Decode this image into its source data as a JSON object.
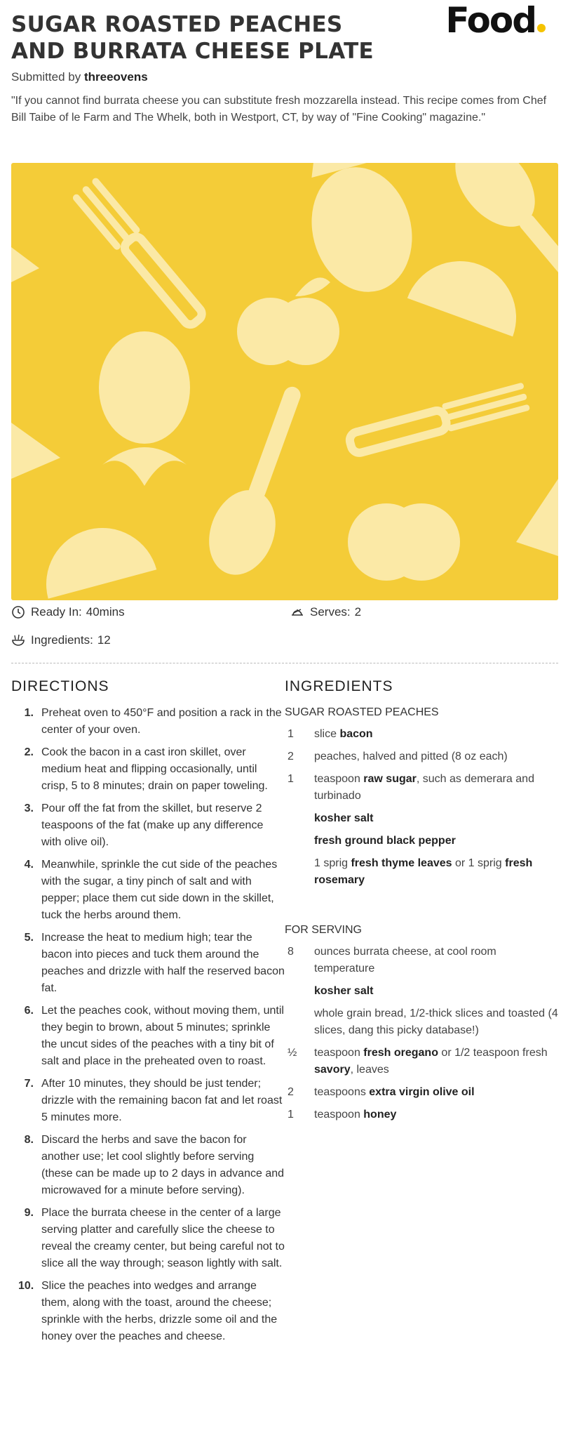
{
  "brand": {
    "logo_text": "Food",
    "accent": "#f5c300"
  },
  "recipe": {
    "title": "SUGAR ROASTED PEACHES AND BURRATA CHEESE PLATE",
    "submitted_prefix": "Submitted by",
    "author": "threeovens",
    "description": "\"If you cannot find burrata cheese you can substitute fresh mozzarella instead. This recipe comes from Chef Bill Taibe of le Farm and The Whelk, both in Westport, CT, by way of \"Fine Cooking\" magazine.\"",
    "hero_color": "#f4cc38"
  },
  "meta": {
    "ready_label": "Ready In:",
    "ready_value": "40mins",
    "serves_label": "Serves:",
    "serves_value": "2",
    "ingredients_label": "Ingredients:",
    "ingredients_value": "12"
  },
  "directions": {
    "title": "DIRECTIONS",
    "steps": [
      {
        "n": "1.",
        "text": "Preheat oven to 450°F and position a rack in the center of your oven."
      },
      {
        "n": "2.",
        "text": "Cook the bacon in a cast iron skillet, over medium heat and flipping occasionally, until crisp, 5 to 8 minutes; drain on paper toweling."
      },
      {
        "n": "3.",
        "text": "Pour off the fat from the skillet, but reserve 2 teaspoons of the fat (make up any difference with olive oil)."
      },
      {
        "n": "4.",
        "text": "Meanwhile, sprinkle the cut side of the peaches with the sugar, a tiny pinch of salt and with pepper; place them cut side down in the skillet, tuck the herbs around them."
      },
      {
        "n": "5.",
        "text": "Increase the heat to medium high; tear the bacon into pieces and tuck them around the peaches and drizzle with half the reserved bacon fat."
      },
      {
        "n": "6.",
        "text": "Let the peaches cook, without moving them, until they begin to brown, about 5 minutes; sprinkle the uncut sides of the peaches with a tiny bit of salt and place in the preheated oven to roast."
      },
      {
        "n": "7.",
        "text": "After 10 minutes, they should be just tender; drizzle with the remaining bacon fat and let roast 5 minutes more."
      },
      {
        "n": "8.",
        "text": "Discard the herbs and save the bacon for another use; let cool slightly before serving (these can be made up to 2 days in advance and microwaved for a minute before serving)."
      },
      {
        "n": "9.",
        "text": "Place the burrata cheese in the center of a large serving platter and carefully slice the cheese to reveal the creamy center, but being careful not to slice all the way through; season lightly with salt."
      },
      {
        "n": "10.",
        "text": "Slice the peaches into wedges and arrange them, along with the toast, around the cheese; sprinkle with the herbs, drizzle some oil and the honey over the peaches and cheese."
      }
    ]
  },
  "ingredients": {
    "title": "INGREDIENTS",
    "group1_title": "SUGAR ROASTED PEACHES",
    "group1": [
      {
        "q": "1",
        "pre": "slice ",
        "bold": "bacon",
        "post": ""
      },
      {
        "q": "2",
        "pre": "peaches, halved and pitted (8 oz each)",
        "bold": "",
        "post": ""
      },
      {
        "q": "1",
        "pre": "teaspoon ",
        "bold": "raw sugar",
        "post": ", such as demerara and turbinado"
      },
      {
        "q": "",
        "pre": "",
        "bold": "kosher salt",
        "post": ""
      },
      {
        "q": "",
        "pre": "",
        "bold": "fresh ground black pepper",
        "post": ""
      },
      {
        "q": "",
        "pre": "1 sprig ",
        "bold": "fresh thyme leaves",
        "post": " or 1 sprig ",
        "bold2": "fresh rosemary"
      }
    ],
    "group2_title": "FOR SERVING",
    "group2": [
      {
        "q": "8",
        "pre": "ounces burrata cheese, at cool room temperature",
        "bold": "",
        "post": ""
      },
      {
        "q": "",
        "pre": "",
        "bold": "kosher salt",
        "post": ""
      },
      {
        "q": "",
        "pre": "whole grain bread, 1/2-thick slices and toasted (4 slices, dang this picky database!)",
        "bold": "",
        "post": ""
      },
      {
        "q": "½",
        "pre": "teaspoon ",
        "bold": "fresh oregano",
        "post": " or 1/2 teaspoon fresh ",
        "bold2": "savory",
        "post2": ", leaves"
      },
      {
        "q": "2",
        "pre": "teaspoons ",
        "bold": "extra virgin olive oil",
        "post": ""
      },
      {
        "q": "1",
        "pre": "teaspoon ",
        "bold": "honey",
        "post": ""
      }
    ]
  }
}
